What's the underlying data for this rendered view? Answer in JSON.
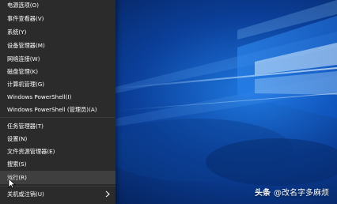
{
  "menu": {
    "items": [
      {
        "label": "电源选项(O)"
      },
      {
        "label": "事件查看器(V)"
      },
      {
        "label": "系统(Y)"
      },
      {
        "label": "设备管理器(M)"
      },
      {
        "label": "网络连接(W)"
      },
      {
        "label": "磁盘管理(K)"
      },
      {
        "label": "计算机管理(G)"
      },
      {
        "label": "Windows PowerShell(I)"
      },
      {
        "label": "Windows PowerShell (管理员)(A)"
      },
      {
        "label": "任务管理器(T)"
      },
      {
        "label": "设置(N)"
      },
      {
        "label": "文件资源管理器(E)"
      },
      {
        "label": "搜索(S)"
      },
      {
        "label": "运行(R)"
      },
      {
        "label": "关机或注销(U)"
      }
    ],
    "chevron_icon": "chevron-right-icon"
  },
  "watermark": {
    "brand": "头条",
    "handle": "@改名字多麻烦"
  },
  "colors": {
    "menu_bg": "#2b2b2b",
    "menu_hover": "#3f3f3f",
    "desktop_blue": "#0a4fb0"
  }
}
